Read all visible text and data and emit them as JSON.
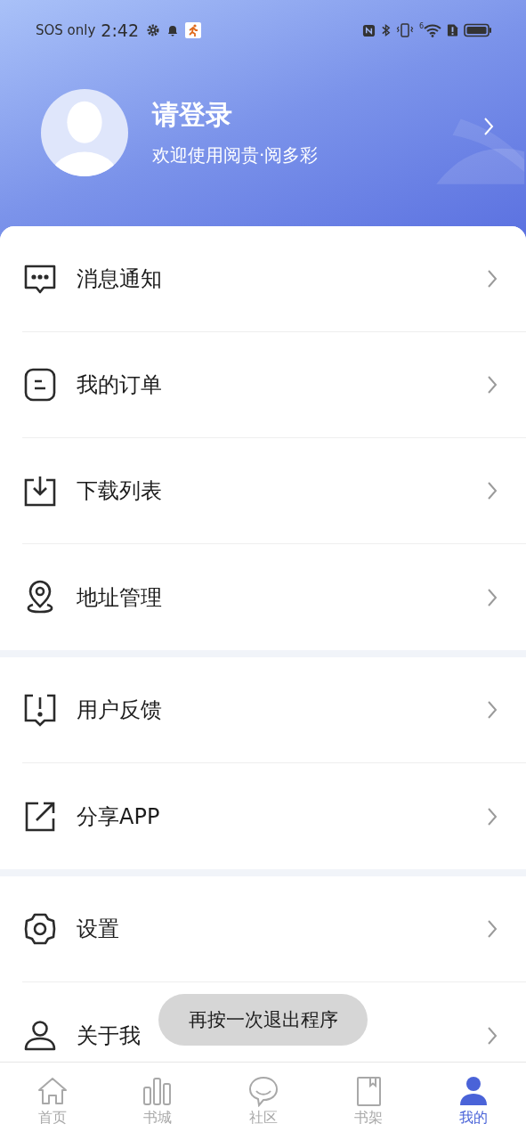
{
  "status_bar": {
    "carrier": "SOS only",
    "time": "2:42",
    "network": "6"
  },
  "profile": {
    "name": "请登录",
    "subtitle": "欢迎使用阅贵·阅多彩"
  },
  "menu_sections": [
    {
      "items": [
        {
          "label": "消息通知"
        },
        {
          "label": "我的订单"
        },
        {
          "label": "下载列表"
        },
        {
          "label": "地址管理"
        }
      ]
    },
    {
      "items": [
        {
          "label": "用户反馈"
        },
        {
          "label": "分享APP"
        }
      ]
    },
    {
      "items": [
        {
          "label": "设置"
        },
        {
          "label": "关于我"
        }
      ]
    }
  ],
  "toast": "再按一次退出程序",
  "bottom_nav": [
    {
      "label": "首页",
      "selected": false
    },
    {
      "label": "书城",
      "selected": false
    },
    {
      "label": "社区",
      "selected": false
    },
    {
      "label": "书架",
      "selected": false
    },
    {
      "label": "我的",
      "selected": true
    }
  ]
}
